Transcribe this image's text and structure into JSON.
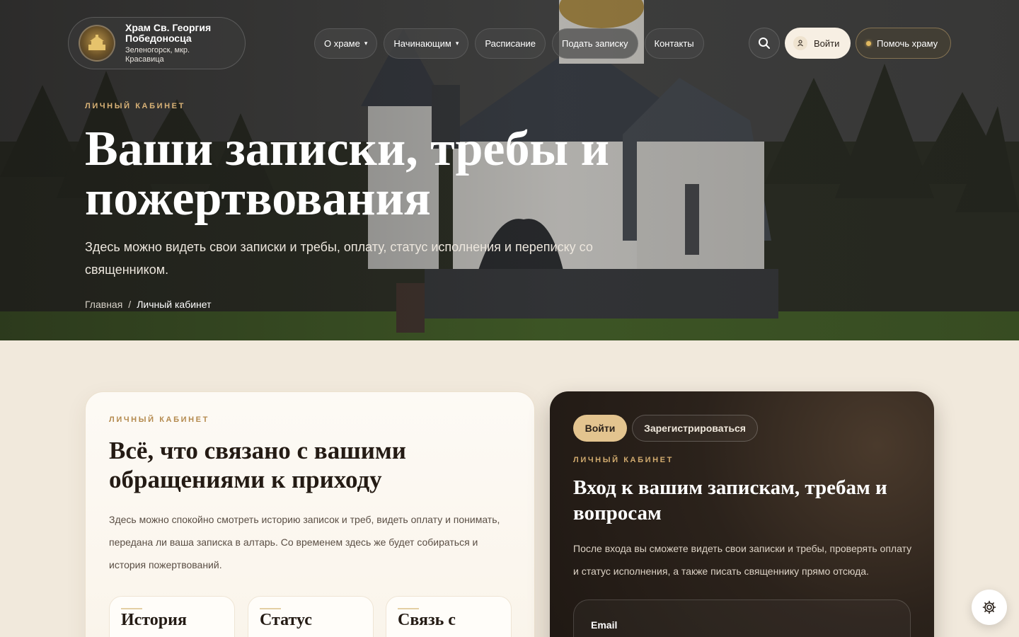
{
  "header": {
    "brand_title": "Храм Св. Георгия Победоносца",
    "brand_subtitle": "Зеленогорск, мкр. Красавица",
    "nav": [
      {
        "label": "О храме",
        "has_caret": true
      },
      {
        "label": "Начинающим",
        "has_caret": true
      },
      {
        "label": "Расписание",
        "has_caret": false
      },
      {
        "label": "Подать записку",
        "has_caret": false
      },
      {
        "label": "Контакты",
        "has_caret": false
      }
    ],
    "caret": "▾",
    "search_icon": "search-icon",
    "login_label": "Войти",
    "help_label": "Помочь храму"
  },
  "hero": {
    "eyebrow": "ЛИЧНЫЙ КАБИНЕТ",
    "title": "Ваши записки, требы и пожертвования",
    "lead": "Здесь можно видеть свои записки и требы, оплату, статус исполнения и переписку со священником.",
    "breadcrumb": {
      "home": "Главная",
      "separator": "/",
      "current": "Личный кабинет"
    }
  },
  "left_card": {
    "eyebrow": "ЛИЧНЫЙ КАБИНЕТ",
    "title": "Всё, что связано с вашими обращениями к приходу",
    "text": "Здесь можно спокойно смотреть историю записок и треб, видеть оплату и понимать, передана ли ваша записка в алтарь. Со временем здесь же будет собираться и история пожертвований.",
    "features": [
      "История",
      "Статус",
      "Связь с"
    ]
  },
  "right_card": {
    "tab_login": "Войти",
    "tab_register": "Зарегистрироваться",
    "eyebrow": "ЛИЧНЫЙ КАБИНЕТ",
    "title": "Вход к вашим запискам, требам и вопросам",
    "text": "После входа вы сможете видеть свои записки и требы, проверять оплату и статус исполнения, а также писать священнику прямо отсюда.",
    "email_label": "Email"
  },
  "colors": {
    "accent": "#e3c48f",
    "dark_card": "#2b221b",
    "eyebrow": "#b48a4e"
  }
}
